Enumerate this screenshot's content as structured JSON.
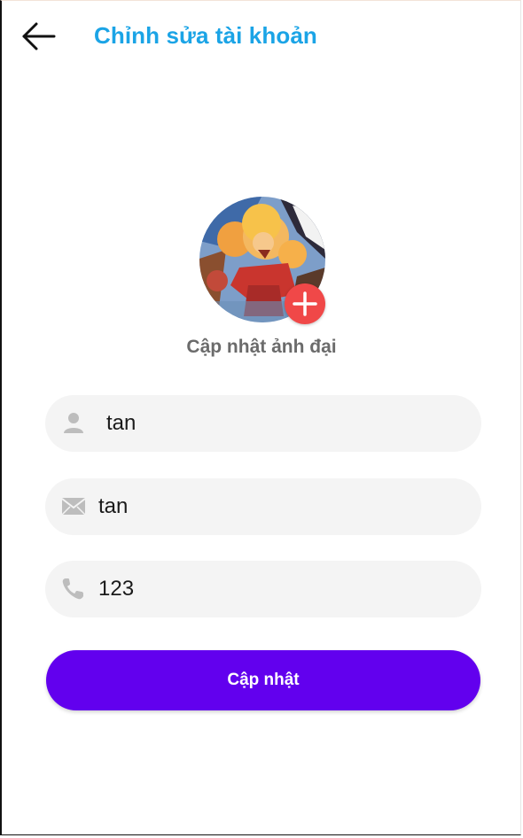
{
  "header": {
    "title": "Chỉnh sửa tài khoản",
    "back_icon": "arrow-left-icon",
    "title_color": "#1ba4e6"
  },
  "avatar": {
    "caption": "Cập nhật ảnh đại",
    "add_icon": "plus-circle-icon",
    "add_color": "#f04848"
  },
  "form": {
    "name": {
      "icon": "person-icon",
      "value": "tan"
    },
    "email": {
      "icon": "envelope-icon",
      "value": "tan"
    },
    "phone": {
      "icon": "phone-icon",
      "value": "123"
    }
  },
  "submit": {
    "label": "Cập nhật",
    "color": "#6200ee"
  }
}
